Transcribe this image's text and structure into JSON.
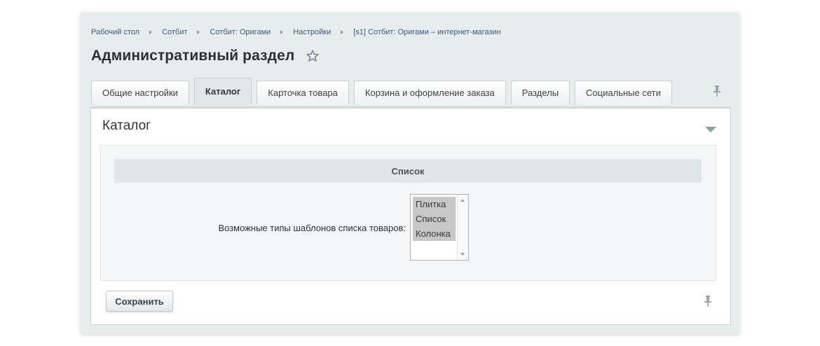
{
  "breadcrumb": [
    "Рабочий стол",
    "Сотбит",
    "Сотбит: Оригами",
    "Настройки",
    "[s1] Сотбит: Оригами – интернет-магазин"
  ],
  "page_title": "Административный раздел",
  "tabs": [
    {
      "label": "Общие настройки",
      "active": false
    },
    {
      "label": "Каталог",
      "active": true
    },
    {
      "label": "Карточка товара",
      "active": false
    },
    {
      "label": "Корзина и оформление заказа",
      "active": false
    },
    {
      "label": "Разделы",
      "active": false
    },
    {
      "label": "Социальные сети",
      "active": false
    }
  ],
  "section": {
    "title": "Каталог",
    "sub_header": "Список",
    "field_label": "Возможные типы шаблонов списка товаров:",
    "options": [
      "Плитка",
      "Список",
      "Колонка"
    ]
  },
  "save_label": "Сохранить",
  "colors": {
    "panel_bg": "#e7eced",
    "link": "#3a5a82",
    "selected_option": "#c7c7c7"
  }
}
